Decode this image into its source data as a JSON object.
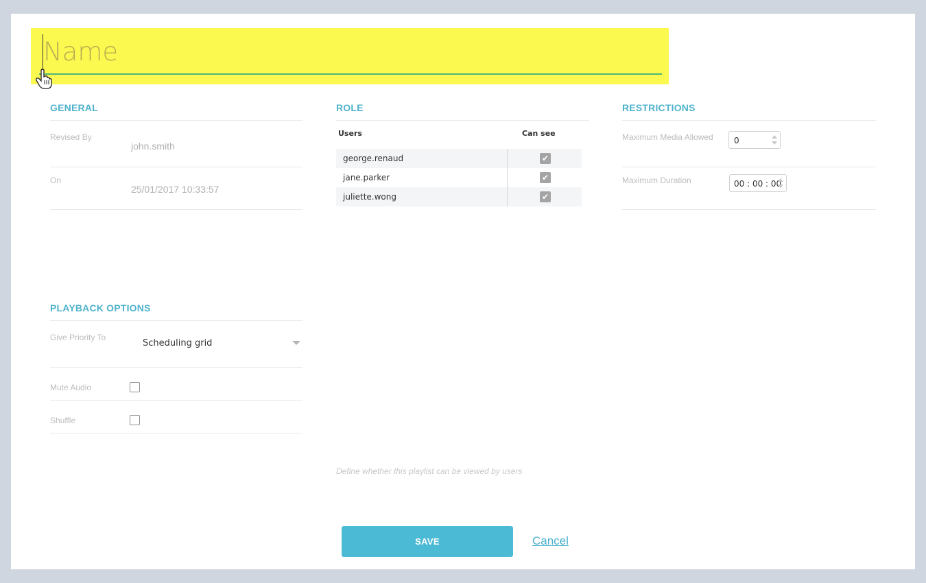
{
  "name_field": {
    "placeholder": "Name"
  },
  "general": {
    "title": "GENERAL",
    "revised_by_label": "Revised By",
    "revised_by_value": "john.smith",
    "on_label": "On",
    "on_value": "25/01/2017 10:33:57"
  },
  "playback": {
    "title": "PLAYBACK OPTIONS",
    "priority_label": "Give Priority To",
    "priority_value": "Scheduling grid",
    "mute_label": "Mute Audio",
    "mute_checked": false,
    "shuffle_label": "Shuffle",
    "shuffle_checked": false
  },
  "role": {
    "title": "ROLE",
    "col_users": "Users",
    "col_can_see": "Can see",
    "rows": [
      {
        "user": "george.renaud",
        "can_see": true
      },
      {
        "user": "jane.parker",
        "can_see": true
      },
      {
        "user": "juliette.wong",
        "can_see": true
      }
    ],
    "hint": "Define whether this playlist can be viewed by users"
  },
  "restrictions": {
    "title": "RESTRICTIONS",
    "max_media_label": "Maximum Media Allowed",
    "max_media_value": "0",
    "max_duration_label": "Maximum Duration",
    "max_duration_value": "00 : 00 : 00"
  },
  "actions": {
    "save_label": "SAVE",
    "cancel_label": "Cancel"
  },
  "colors": {
    "accent": "#4bbad4",
    "highlight": "#fbf84f",
    "background": "#cfd6df"
  }
}
